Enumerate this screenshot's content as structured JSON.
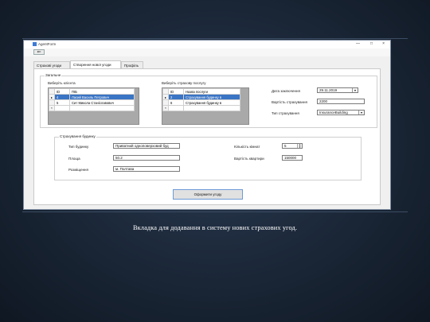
{
  "window": {
    "title": "AgentForm",
    "min": "—",
    "max": "□",
    "close": "×"
  },
  "back_label": "⇐",
  "tabs": [
    {
      "label": "Страхові угоди"
    },
    {
      "label": "Створення нової угоди"
    },
    {
      "label": "Профіль"
    }
  ],
  "general": {
    "title": "Загальне",
    "client_label": "Виберіть клієнта",
    "clients": {
      "headers": [
        "ID",
        "ПІБ"
      ],
      "rows": [
        {
          "marker": "▸",
          "id": "4",
          "name": "Ласий Василь Петрович"
        },
        {
          "marker": "",
          "id": "5",
          "name": "Сит Микола Станіславович"
        },
        {
          "marker": "*",
          "id": "",
          "name": ""
        }
      ]
    },
    "service_label": "Виберіть страхову послугу",
    "services": {
      "headers": [
        "ID",
        "Назва послуги"
      ],
      "rows": [
        {
          "marker": "▸",
          "id": "2",
          "name": "Страхування будинку в"
        },
        {
          "marker": "",
          "id": "6",
          "name": "Страхування будинку в"
        },
        {
          "marker": "*",
          "id": "",
          "name": ""
        }
      ]
    },
    "date_label": "Дата заключення",
    "date_value": "29.11.2019",
    "cost_label": "Вартість страхування",
    "cost_value": "2200",
    "type_label": "Тип страхування",
    "type_value": "InsuranceBuilding"
  },
  "building": {
    "title": "Страхування будинку",
    "type_label": "Тип будинку",
    "type_value": "Приватний одноповерховий буд",
    "area_label": "Площа",
    "area_value": "50.2",
    "location_label": "Розміщення",
    "location_value": "м. Полтава",
    "rooms_label": "Кількість кімнат",
    "rooms_value": "5",
    "price_label": "Вартість квартири",
    "price_value": "150000"
  },
  "submit_label": "Оформити угоду",
  "caption": "Вкладка для додавання в систему нових страхових угод."
}
